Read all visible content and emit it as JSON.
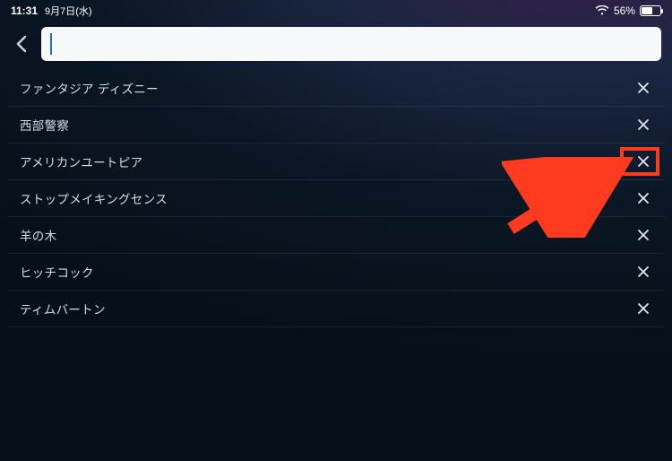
{
  "status": {
    "time": "11:31",
    "date": "9月7日(水)",
    "battery_pct": "56%",
    "battery_level": 56
  },
  "search": {
    "value": "",
    "placeholder": ""
  },
  "history": [
    {
      "label": "ファンタジア ディズニー",
      "highlighted": false
    },
    {
      "label": "西部警察",
      "highlighted": false
    },
    {
      "label": "アメリカンユートピア",
      "highlighted": true
    },
    {
      "label": "ストップメイキングセンス",
      "highlighted": false
    },
    {
      "label": "羊の木",
      "highlighted": false
    },
    {
      "label": "ヒッチコック",
      "highlighted": false
    },
    {
      "label": "ティムバートン",
      "highlighted": false
    }
  ],
  "annotation": {
    "arrow_color": "#ff3b1f"
  }
}
